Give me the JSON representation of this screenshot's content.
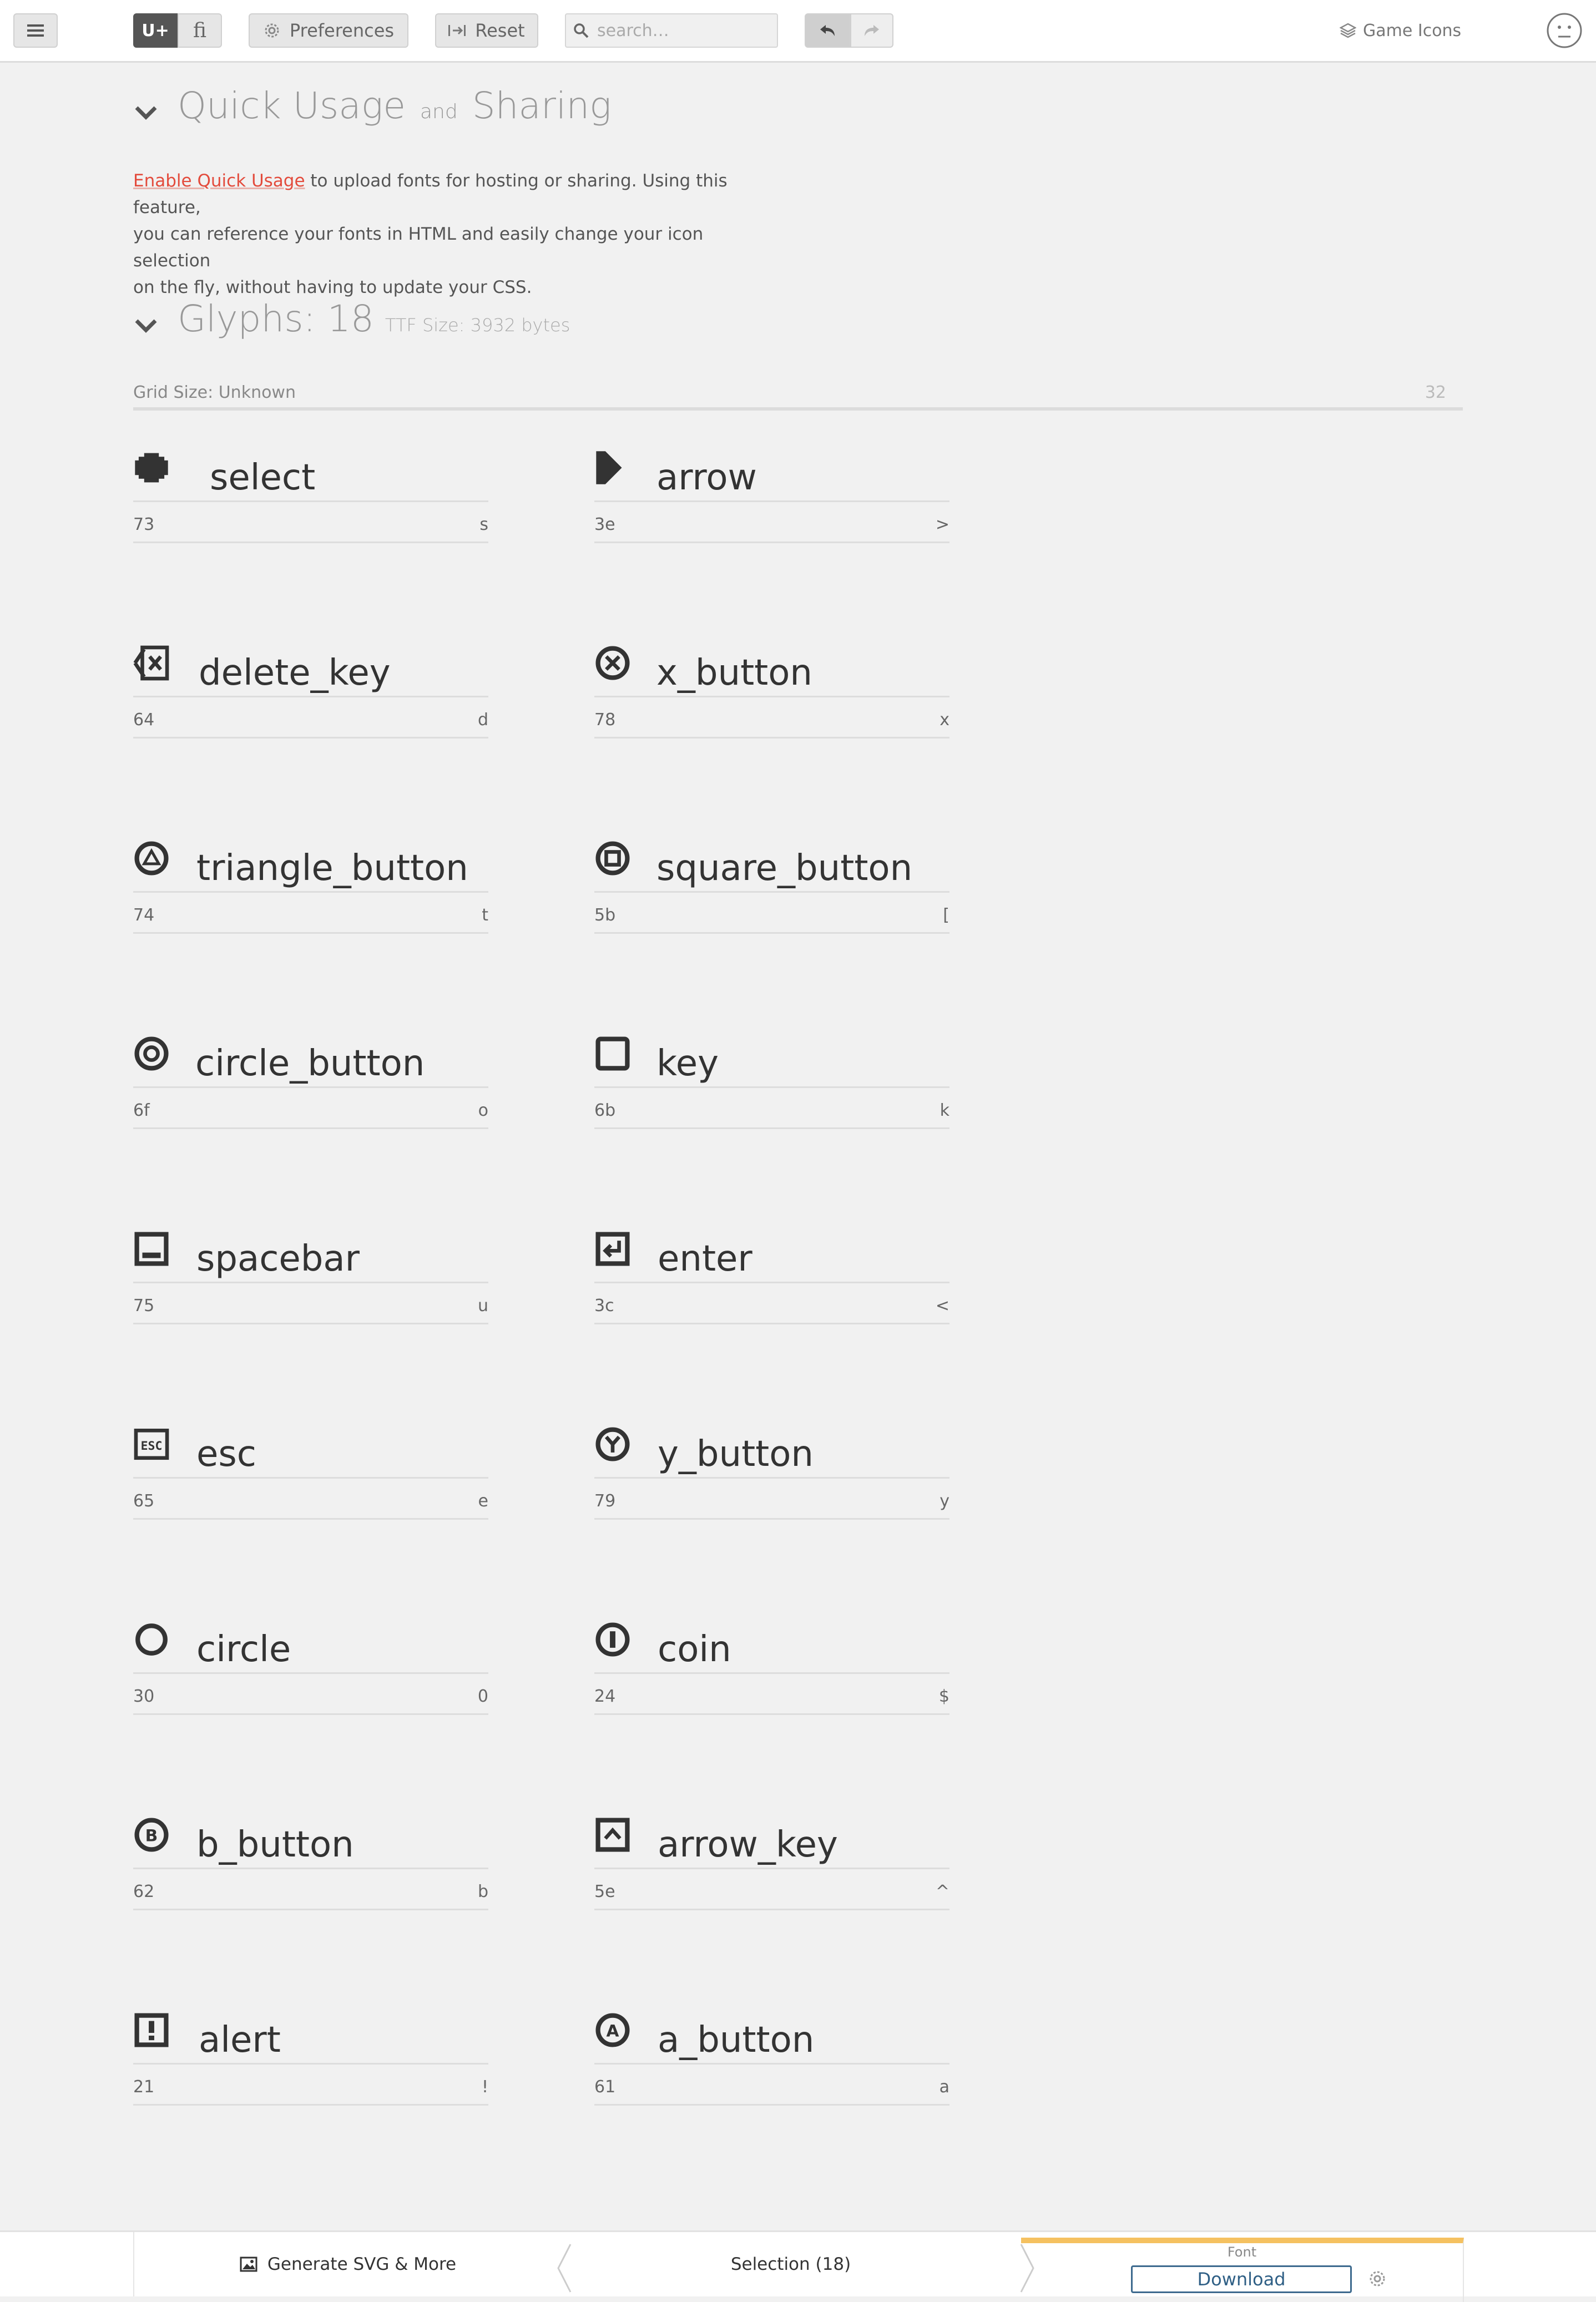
{
  "toolbar": {
    "unicode_toggle": "U+",
    "ligature_toggle": "ﬁ",
    "preferences_label": "Preferences",
    "reset_label": "Reset",
    "search_placeholder": "search…",
    "project_name": "Game Icons"
  },
  "quick_usage": {
    "title_part1": "Quick Usage",
    "title_and": "and",
    "title_part2": "Sharing",
    "link_text": "Enable Quick Usage",
    "line1_rest": " to upload fonts for hosting or sharing. Using this feature,",
    "line2": "you can reference your fonts in HTML and easily change your icon selection",
    "line3": "on the fly, without having to update your CSS."
  },
  "glyphs_section": {
    "title": "Glyphs: 18",
    "ttf_size": "TTF Size: 3932 bytes",
    "grid_size": "Grid Size: Unknown",
    "grid_value": "32"
  },
  "glyphs": [
    {
      "name": "select",
      "code": "73",
      "char": "s",
      "icon": "select-icon"
    },
    {
      "name": "arrow",
      "code": "3e",
      "char": ">",
      "icon": "arrow-icon"
    },
    {
      "name": "delete_key",
      "code": "64",
      "char": "d",
      "icon": "delete-key-icon"
    },
    {
      "name": "x_button",
      "code": "78",
      "char": "x",
      "icon": "x-button-icon"
    },
    {
      "name": "triangle_button",
      "code": "74",
      "char": "t",
      "icon": "triangle-button-icon"
    },
    {
      "name": "square_button",
      "code": "5b",
      "char": "[",
      "icon": "square-button-icon"
    },
    {
      "name": "circle_button",
      "code": "6f",
      "char": "o",
      "icon": "circle-button-icon"
    },
    {
      "name": "key",
      "code": "6b",
      "char": "k",
      "icon": "key-icon"
    },
    {
      "name": "spacebar",
      "code": "75",
      "char": "u",
      "icon": "spacebar-icon"
    },
    {
      "name": "enter",
      "code": "3c",
      "char": "<",
      "icon": "enter-icon"
    },
    {
      "name": "esc",
      "code": "65",
      "char": "e",
      "icon": "esc-icon"
    },
    {
      "name": "y_button",
      "code": "79",
      "char": "y",
      "icon": "y-button-icon"
    },
    {
      "name": "circle",
      "code": "30",
      "char": "0",
      "icon": "circle-icon"
    },
    {
      "name": "coin",
      "code": "24",
      "char": "$",
      "icon": "coin-icon"
    },
    {
      "name": "b_button",
      "code": "62",
      "char": "b",
      "icon": "b-button-icon"
    },
    {
      "name": "arrow_key",
      "code": "5e",
      "char": "^",
      "icon": "arrow-key-icon"
    },
    {
      "name": "alert",
      "code": "21",
      "char": "!",
      "icon": "alert-icon"
    },
    {
      "name": "a_button",
      "code": "61",
      "char": "a",
      "icon": "a-button-icon"
    }
  ],
  "bottom_bar": {
    "generate_label": "Generate SVG & More",
    "selection_label": "Selection (18)",
    "font_label": "Font",
    "download_label": "Download"
  },
  "colors": {
    "accent_link": "#e34b3c",
    "download_border": "#3d6a8e",
    "font_tab_highlight": "#f5c160"
  }
}
